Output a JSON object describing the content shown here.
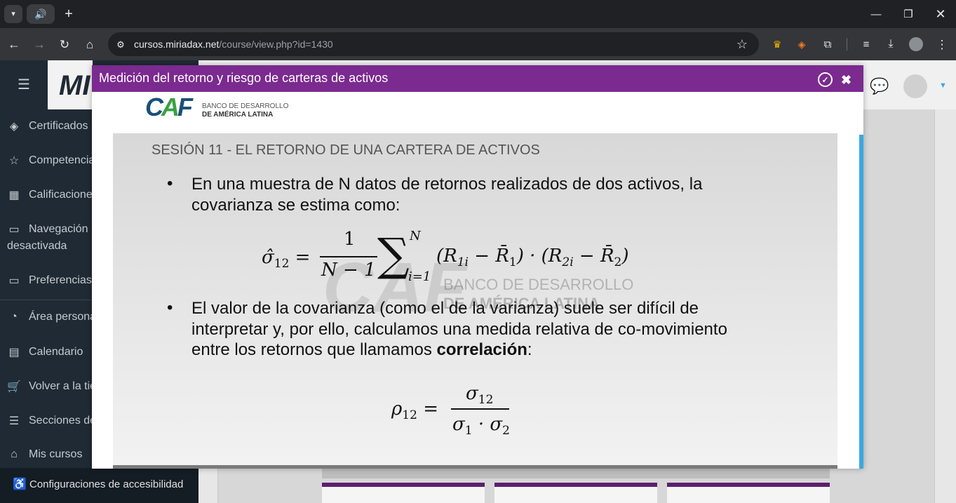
{
  "browser": {
    "url_host": "cursos.miriadax.net",
    "url_path": "/course/view.php?id=1430",
    "icons": [
      "tab-list-icon",
      "speaker-icon",
      "new-tab-icon",
      "minimize-icon",
      "restore-icon",
      "close-window-icon",
      "back-icon",
      "forward-icon",
      "reload-icon",
      "home-icon",
      "site-info-icon",
      "star-icon",
      "crown-icon",
      "grad-cap-icon",
      "extensions-icon",
      "media-icon",
      "download-icon",
      "profile-icon",
      "menu-icon"
    ]
  },
  "site": {
    "brand": "MI",
    "nav": [
      {
        "label": "Certificados",
        "icon": "layers-icon"
      },
      {
        "label": "Competencias",
        "icon": "star-icon"
      },
      {
        "label": "Calificaciones",
        "icon": "gradebook-icon"
      },
      {
        "label": "Navegación",
        "label2": "desactivada",
        "icon": "folder-icon"
      },
      {
        "label": "Preferencias",
        "icon": "folder-icon"
      },
      {
        "label": "Área personal",
        "icon": "dashboard-icon"
      },
      {
        "label": "Calendario",
        "icon": "calendar-icon"
      },
      {
        "label": "Volver a la tienda",
        "icon": "cart-icon"
      },
      {
        "label": "Secciones del curso",
        "icon": "list-icon"
      },
      {
        "label": "Mis cursos",
        "icon": "grad-icon"
      }
    ],
    "accessibility": "Configuraciones de accesibilidad"
  },
  "modal": {
    "title": "Medición del retorno y riesgo de carteras de activos"
  },
  "slide": {
    "logo_line1": "BANCO DE DESARROLLO",
    "logo_line2": "DE AMÉRICA LATINA",
    "watermark_line1": "BANCO DE DESARROLLO",
    "watermark_line2": "DE AMÉRICA LATINA",
    "session": "SESIÓN 11 - EL RETORNO DE UNA CARTERA DE ACTIVOS",
    "bullet1_line1": "En una muestra de N datos de retornos realizados de dos activos, la",
    "bullet1_line2": "covarianza se estima como:",
    "bullet2_line1": "El valor de la covarianza (como el de la varianza) suele ser difícil de",
    "bullet2_line2": "interpretar y, por ello, calculamos una medida relativa de co-movimiento",
    "bullet2_line3_pre": "entre los retornos que llamamos ",
    "bullet2_line3_bold": "correlación",
    "bullet2_line3_post": ":"
  },
  "colors": {
    "modal_header": "#7b2a8f",
    "sidebar": "#1f2a34",
    "scrollbar": "#3aa8e0"
  }
}
